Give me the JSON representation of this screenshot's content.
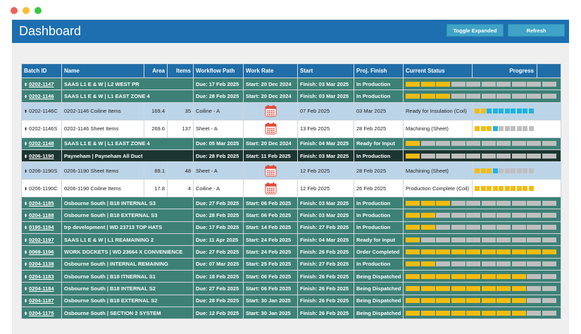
{
  "window": {
    "dots": [
      "#f05f57",
      "#f9bd2e",
      "#3bc744"
    ]
  },
  "header": {
    "title": "Dashboard",
    "toggle_label": "Toggle Expanded",
    "refresh_label": "Refresh"
  },
  "columns": [
    "Batch ID",
    "Name",
    "Area",
    "Items",
    "Workflow Path",
    "Work Rate",
    "Start",
    "Proj. Finish",
    "Current Status",
    "Progress"
  ],
  "rows": [
    {
      "kind": "batch",
      "id": "0202-1147",
      "name": "SAAS L1 E & W | L2 WEST PR",
      "work": "Due: 17 Feb 2025",
      "rate": "Start: 20 Dec 2024",
      "start": "Finish: 03 Mar 2025",
      "status": "In Production",
      "filled": 3
    },
    {
      "kind": "batch",
      "id": "0202-1146",
      "name": "SAAS L1 E & W | L1 EAST ZONE 4",
      "work": "Due: 28 Feb 2025",
      "rate": "Start: 20 Dec 2024",
      "start": "Finish: 03 Mar 2025",
      "status": "In Production",
      "filled": 3
    },
    {
      "kind": "sub",
      "style": "alt",
      "id": "0202-1146C",
      "name": "0202-1146 Coiline Items",
      "area": "169.4",
      "items": "35",
      "work": "Coiline - A",
      "start": "07 Feb 2025",
      "finish": "03 Mar 2025",
      "status": "Ready for Insulation (Coil)",
      "steps": [
        "y",
        "y",
        "c",
        "c",
        "c",
        "c",
        "c",
        "c",
        "c",
        "c"
      ]
    },
    {
      "kind": "sub",
      "style": "wh",
      "id": "0202-1146S",
      "name": "0202-1146 Sheet Items",
      "area": "269.6",
      "items": "137",
      "work": "Sheet - A",
      "start": "13 Feb 2025",
      "finish": "28 Feb 2025",
      "status": "Machining (Sheet)",
      "steps": [
        "y",
        "y",
        "y",
        "c",
        "g",
        "g",
        "g",
        "g",
        "g",
        "g"
      ]
    },
    {
      "kind": "batch",
      "id": "0202-1148",
      "name": "SAAS L1 E & W | L1 EAST ZONE 4",
      "work": "Due: 05 Mar 2025",
      "rate": "Start: 20 Dec 2024",
      "start": "Finish: 04 Mar 2025",
      "status": "Ready for Input",
      "filled": 1
    },
    {
      "kind": "batch",
      "dark": true,
      "id": "0206-1190",
      "name": "Payneham | Payneham All Duct",
      "work": "Due: 28 Feb 2025",
      "rate": "Start: 11 Feb 2025",
      "start": "Finish: 03 Mar 2025",
      "status": "In Production",
      "filled": 1
    },
    {
      "kind": "sub",
      "style": "alt",
      "id": "0206-1190S",
      "name": "0206-1190 Sheet Items",
      "area": "89.1",
      "items": "48",
      "work": "Sheet - A",
      "start": "12 Feb 2025",
      "finish": "28 Feb 2025",
      "status": "Machining (Sheet)",
      "steps": [
        "y",
        "y",
        "y",
        "c",
        "g",
        "g",
        "g",
        "g",
        "g",
        "g"
      ]
    },
    {
      "kind": "sub",
      "style": "wh",
      "id": "0206-1190C",
      "name": "0206-1190 Coiline Items",
      "area": "17.8",
      "items": "4",
      "work": "Coiline - A",
      "start": "12 Feb 2025",
      "finish": "26 Feb 2025",
      "status": "Production Complete (Coil)",
      "steps": [
        "y",
        "y",
        "y",
        "y",
        "y",
        "y",
        "y",
        "y",
        "y",
        "y"
      ]
    },
    {
      "kind": "batch",
      "id": "0204-1185",
      "name": "Osbourne South | B18 INTERNAL S3",
      "work": "Due: 27 Feb 2025",
      "rate": "Start: 06 Feb 2025",
      "start": "Finish: 03 Mar 2025",
      "status": "In Production",
      "filled": 3
    },
    {
      "kind": "batch",
      "id": "0204-1188",
      "name": "Osbourne South | B18 EXTERNAL S3",
      "work": "Due: 28 Feb 2025",
      "rate": "Start: 06 Feb 2025",
      "start": "Finish: 03 Mar 2025",
      "status": "In Production",
      "filled": 2
    },
    {
      "kind": "batch",
      "id": "0195-1194",
      "name": "trp development | WD 23713 TOP HATS",
      "work": "Due: 17 Feb 2025",
      "rate": "Start: 14 Feb 2025",
      "start": "Finish: 27 Feb 2025",
      "status": "In Production",
      "filled": 2
    },
    {
      "kind": "batch",
      "id": "0202-1197",
      "name": "SAAS L1 E & W | L1 REAMAINING 2",
      "work": "Due: 11 Apr 2025",
      "rate": "Start: 24 Feb 2025",
      "start": "Finish: 04 Mar 2025",
      "status": "Ready for Input",
      "filled": 1
    },
    {
      "kind": "batch",
      "id": "0069-1196",
      "name": "WORK DOCKETS | WD 23664 X CONVENIENCE",
      "work": "Due: 27 Feb 2025",
      "rate": "Start: 24 Feb 2025",
      "start": "Finish: 26 Feb 2025",
      "status": "Order Completed",
      "filled": 10
    },
    {
      "kind": "batch",
      "id": "0204-1138",
      "name": "Osbourne South | INTERNAL REMAINING",
      "work": "Due: 07 Mar 2025",
      "rate": "Start: 25 Feb 2025",
      "start": "Finish: 27 Feb 2025",
      "status": "In Production",
      "filled": 2
    },
    {
      "kind": "batch",
      "id": "0204-1183",
      "name": "Osbourne South | B18 ITNERNAL S1",
      "work": "Due: 18 Feb 2025",
      "rate": "Start: 06 Feb 2025",
      "start": "Finish: 26 Feb 2025",
      "status": "Being Dispatched",
      "filled": 8
    },
    {
      "kind": "batch",
      "id": "0204-1184",
      "name": "Osbourne South | B18 INTERNAL S2",
      "work": "Due: 27 Feb 2025",
      "rate": "Start: 06 Feb 2025",
      "start": "Finish: 26 Feb 2025",
      "status": "Being Dispatched",
      "filled": 8
    },
    {
      "kind": "batch",
      "id": "0204-1187",
      "name": "Osbourne South | B18 EXTERNAL S2",
      "work": "Due: 28 Feb 2025",
      "rate": "Start: 30 Jan 2025",
      "start": "Finish: 26 Feb 2025",
      "status": "Being Dispatched",
      "filled": 8
    },
    {
      "kind": "batch",
      "id": "0204-1175",
      "name": "Osbourne South | SECTION 2 SYSTEM",
      "work": "Due: 12 Feb 2025",
      "rate": "Start: 30 Jan 2025",
      "start": "Finish: 26 Feb 2025",
      "status": "Being Dispatched",
      "filled": 8
    }
  ]
}
